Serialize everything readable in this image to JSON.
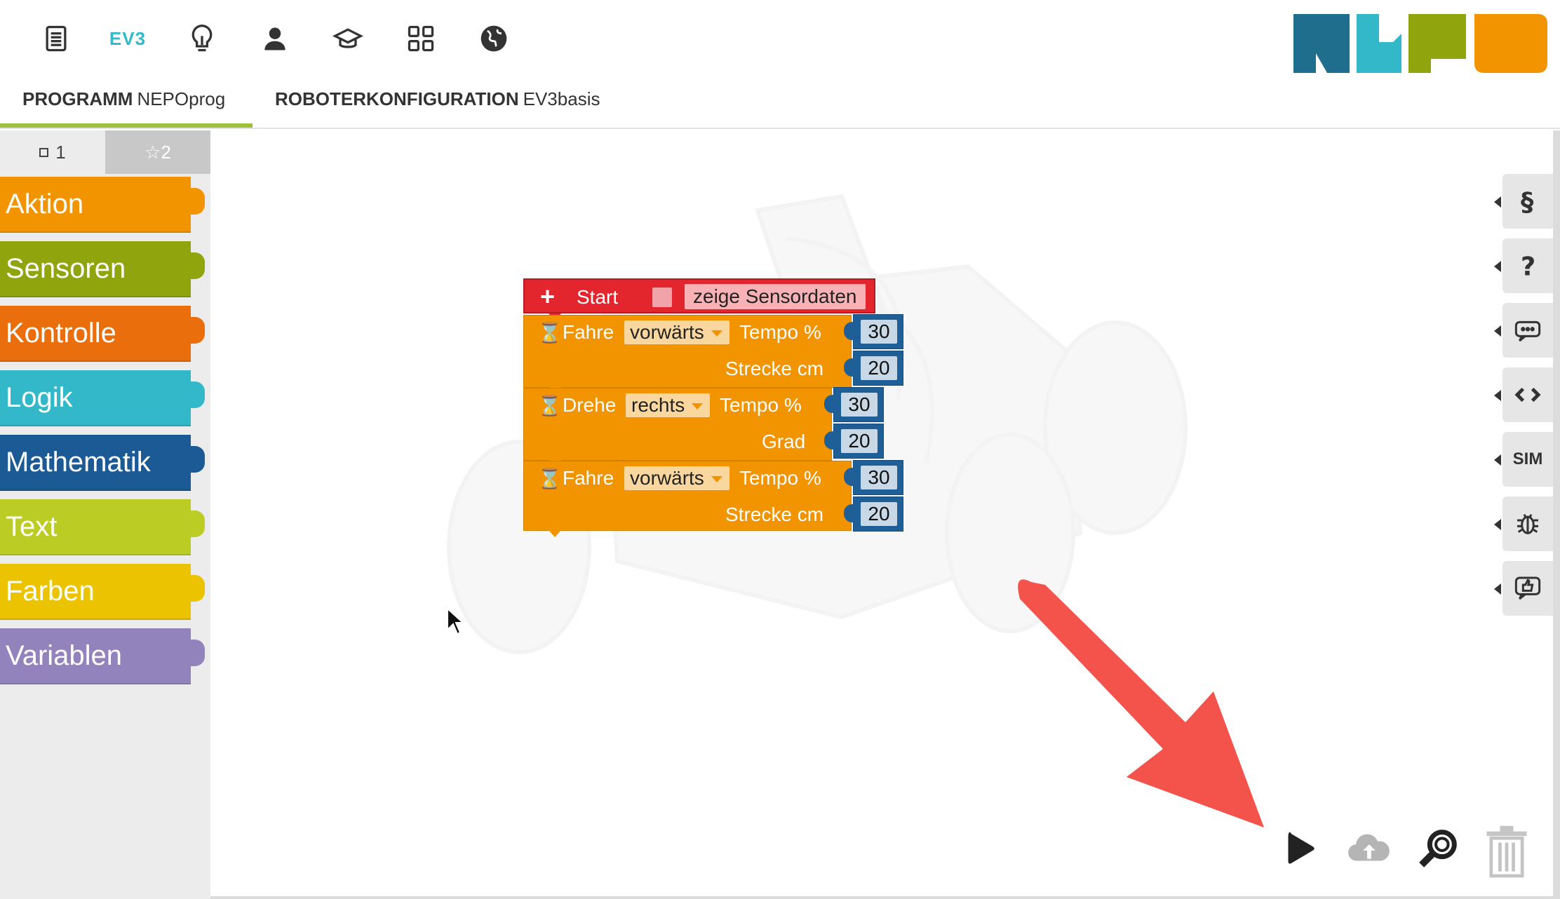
{
  "header": {
    "ev3_label": "EV3",
    "tabs": [
      {
        "bold": "PROGRAMM",
        "name": "NEPOprog"
      },
      {
        "bold": "ROBOTERKONFIGURATION",
        "name": "EV3basis"
      }
    ]
  },
  "toolbox": {
    "tabs": [
      {
        "label": "1"
      },
      {
        "label": "☆2"
      }
    ],
    "categories": [
      {
        "label": "Aktion",
        "color": "#f29300"
      },
      {
        "label": "Sensoren",
        "color": "#8fa40d"
      },
      {
        "label": "Kontrolle",
        "color": "#eb6e0c"
      },
      {
        "label": "Logik",
        "color": "#33b8ca"
      },
      {
        "label": "Mathematik",
        "color": "#1b5a94"
      },
      {
        "label": "Text",
        "color": "#bbcd24"
      },
      {
        "label": "Farben",
        "color": "#ebc300"
      },
      {
        "label": "Variablen",
        "color": "#9383bd"
      }
    ]
  },
  "program": {
    "start_label": "Start",
    "show_sensor_label": "zeige Sensordaten",
    "blocks": [
      {
        "command": "Fahre",
        "direction": "vorwärts",
        "speed_label": "Tempo %",
        "speed": "30",
        "param_label": "Strecke cm",
        "param": "20"
      },
      {
        "command": "Drehe",
        "direction": "rechts",
        "speed_label": "Tempo %",
        "speed": "30",
        "param_label": "Grad",
        "param": "20"
      },
      {
        "command": "Fahre",
        "direction": "vorwärts",
        "speed_label": "Tempo %",
        "speed": "30",
        "param_label": "Strecke cm",
        "param": "20"
      }
    ]
  },
  "sidebar_right": {
    "sim_label": "SIM"
  },
  "colors": {
    "start_block": "#e3262d",
    "action_block": "#f29300",
    "number_block": "#1f5f97",
    "arrow": "#f4534c",
    "tab_underline": "#9cc136"
  }
}
